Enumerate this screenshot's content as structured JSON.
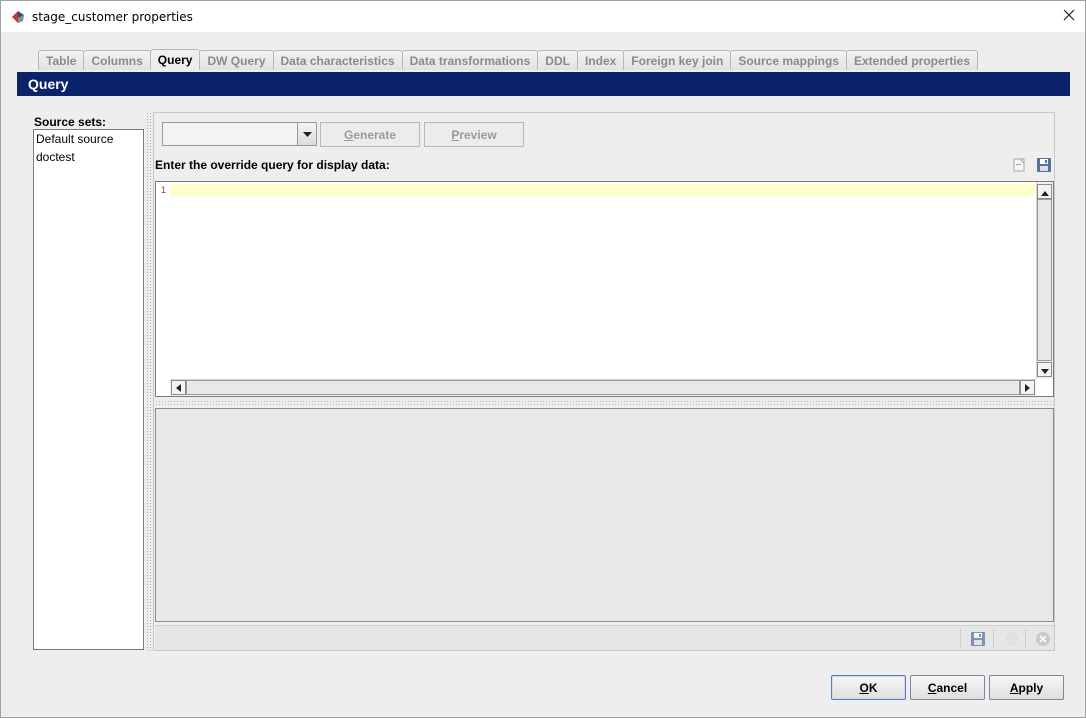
{
  "window": {
    "title": "stage_customer properties"
  },
  "tabs": [
    {
      "label": "Table",
      "active": false
    },
    {
      "label": "Columns",
      "active": false
    },
    {
      "label": "Query",
      "active": true
    },
    {
      "label": "DW Query",
      "active": false
    },
    {
      "label": "Data characteristics",
      "active": false
    },
    {
      "label": "Data transformations",
      "active": false
    },
    {
      "label": "DDL",
      "active": false
    },
    {
      "label": "Index",
      "active": false
    },
    {
      "label": "Foreign key join",
      "active": false
    },
    {
      "label": "Source mappings",
      "active": false
    },
    {
      "label": "Extended properties",
      "active": false
    }
  ],
  "section": {
    "title": "Query"
  },
  "source_sets": {
    "label": "Source sets:",
    "items": [
      "Default source",
      "doctest"
    ]
  },
  "toolbar": {
    "combo_value": "",
    "generate_label": "Generate",
    "generate_mnemonic": "G",
    "generate_rest": "enerate",
    "preview_label": "Preview",
    "preview_mnemonic": "P",
    "preview_rest": "review"
  },
  "query": {
    "label": "Enter the override query for display data:",
    "line_number": "1",
    "text": ""
  },
  "buttons": {
    "ok": {
      "mnemonic": "O",
      "rest": "K"
    },
    "cancel": {
      "mnemonic": "C",
      "rest": "ancel"
    },
    "apply": {
      "mnemonic": "A",
      "rest": "pply"
    }
  },
  "icons": {
    "app": "app-logo-icon",
    "close": "close-icon",
    "new_query": "new-document-icon",
    "save_query": "save-icon",
    "save_results": "save-icon",
    "run": "gear-icon",
    "stop": "stop-icon"
  },
  "colors": {
    "section_bar": "#0b2469",
    "current_line": "#ffffcc",
    "save_icon": "#5a6f95"
  }
}
